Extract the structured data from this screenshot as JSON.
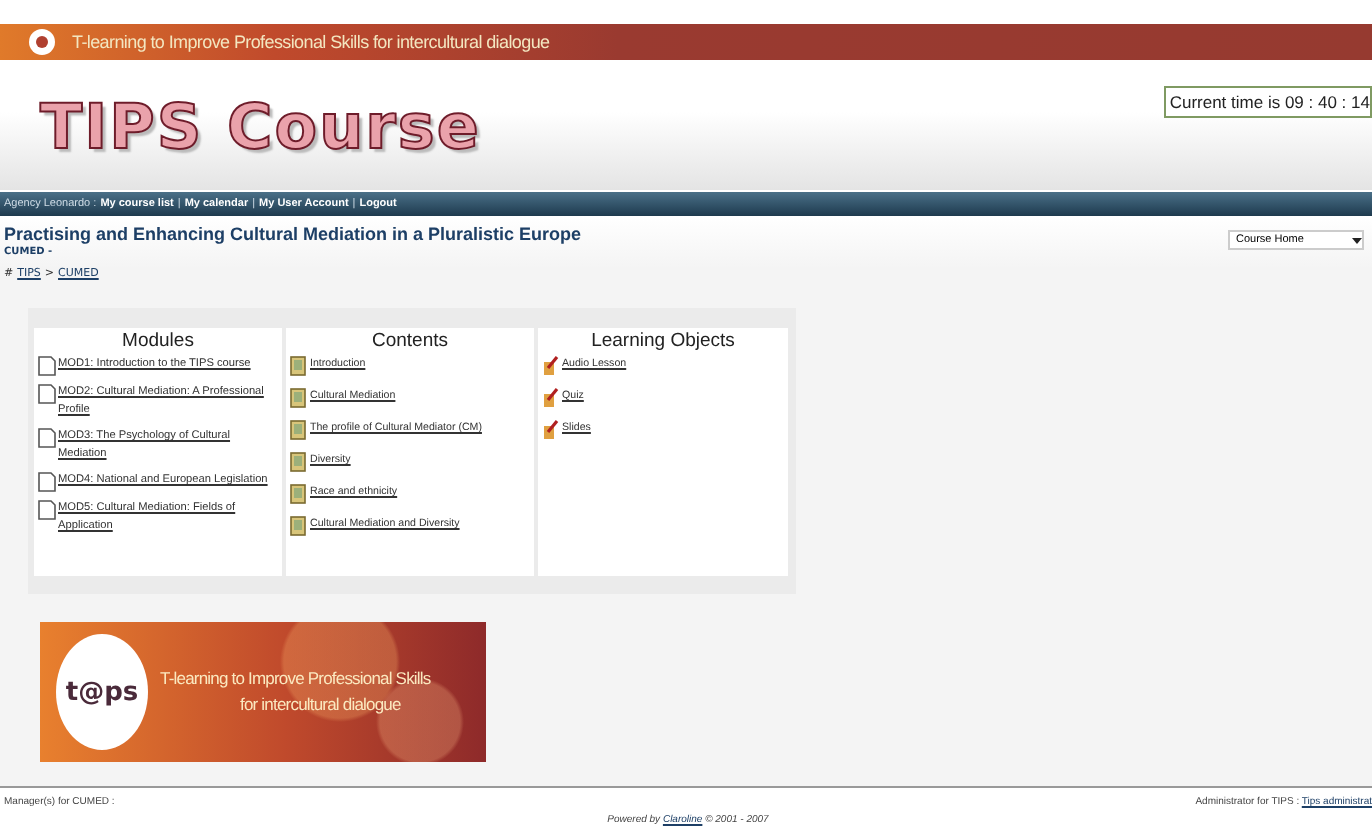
{
  "topbar": {
    "title": "T-learning to Improve Professional Skills for intercultural dialogue"
  },
  "header": {
    "logo": "TIPS Course",
    "time": "Current time is 09 : 40 : 14"
  },
  "nav": {
    "user": "Agency Leonardo :",
    "separator": "|",
    "links": [
      "My course list",
      "My calendar",
      "My User Account",
      "Logout"
    ]
  },
  "course": {
    "title": "Practising and Enhancing Cultural Mediation in a Pluralistic Europe",
    "code": "CUMED -",
    "breadcrumb_prefix": "#",
    "separator": ">",
    "breadcrumb": [
      "TIPS",
      "CUMED"
    ],
    "tool_select": {
      "value": "Course Home"
    }
  },
  "columns": [
    {
      "heading": "Modules",
      "kind": "module",
      "items": [
        "MOD1: Introduction to the TIPS course",
        "MOD2: Cultural Mediation: A Professional Profile",
        "MOD3: The Psychology of Cultural Mediation",
        "MOD4: National and European Legislation",
        "MOD5: Cultural Mediation: Fields of Application"
      ]
    },
    {
      "heading": "Contents",
      "kind": "content",
      "items": [
        "Introduction",
        "Cultural Mediation",
        "The profile of Cultural Mediator (CM)",
        "Diversity",
        "Race and ethnicity",
        "Cultural Mediation and Diversity"
      ]
    },
    {
      "heading": "Learning Objects",
      "kind": "object",
      "items": [
        "Audio Lesson",
        "Quiz",
        "Slides"
      ]
    }
  ],
  "banner": {
    "logo": "t@ps",
    "line1": "T-learning to Improve Professional Skills",
    "line2": "for intercultural dialogue"
  },
  "footer": {
    "managers": "Manager(s) for CUMED :",
    "powered_prefix": "Powered by",
    "powered_link": "Claroline",
    "powered_suffix": "© 2001 - 2007",
    "admin": "Administrator for TIPS :",
    "admin_link": "Tips administrat"
  }
}
